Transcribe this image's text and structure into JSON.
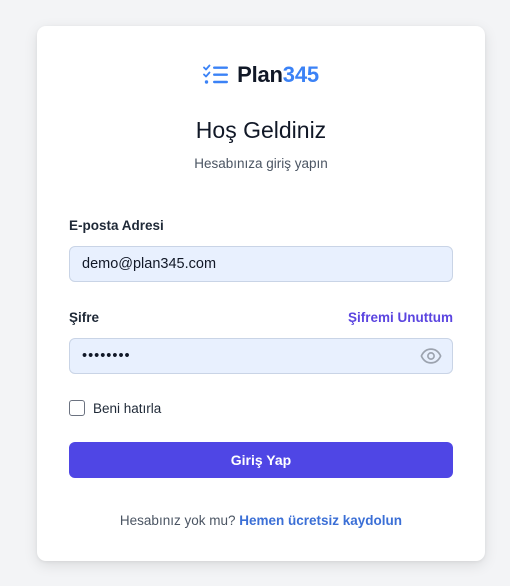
{
  "brand": {
    "name_part1": "Plan",
    "name_part2": "345",
    "icon": "checklist-icon"
  },
  "header": {
    "title": "Hoş Geldiniz",
    "subtitle": "Hesabınıza giriş yapın"
  },
  "form": {
    "email_label": "E-posta Adresi",
    "email_value": "demo@plan345.com",
    "password_label": "Şifre",
    "password_value": "••••••••",
    "forgot_label": "Şifremi Unuttum",
    "remember_label": "Beni hatırla",
    "remember_checked": false,
    "submit_label": "Giriş Yap",
    "password_toggle_icon": "eye-icon"
  },
  "footer": {
    "prompt": "Hesabınız yok mu?",
    "signup_label": "Hemen ücretsiz kaydolun"
  },
  "colors": {
    "primary": "#4f46e5",
    "brand_accent": "#3b82f6",
    "input_bg": "#e8f0fe",
    "link": "#5b45e0"
  }
}
